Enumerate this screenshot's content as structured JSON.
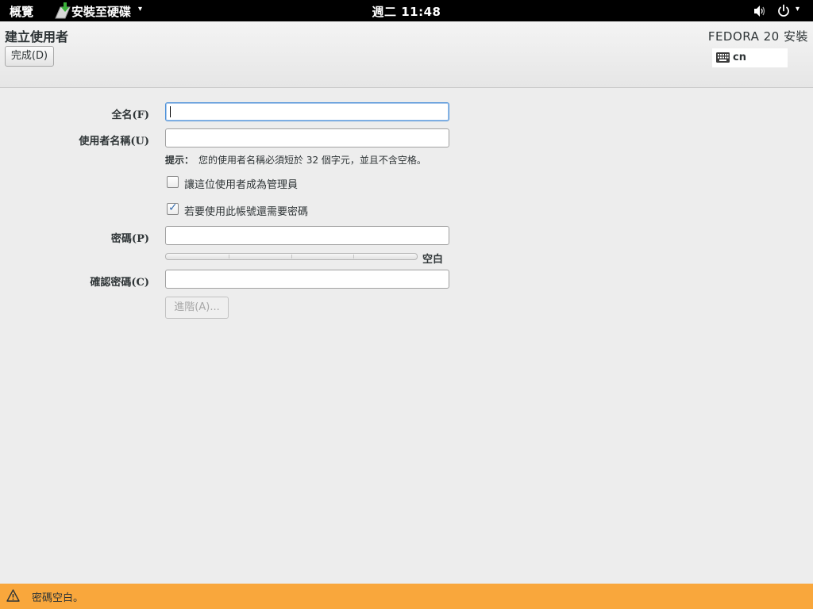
{
  "topbar": {
    "activities_label": "概覽",
    "app_name": "安裝至硬碟",
    "clock": "週二 11:48"
  },
  "header": {
    "title": "建立使用者",
    "done_label": "完成(D)",
    "product_title": "FEDORA 20 安裝",
    "keyboard_layout": "cn"
  },
  "form": {
    "fullname_label": "全名(F)",
    "fullname_value": "",
    "username_label": "使用者名稱(U)",
    "username_value": "",
    "hint_label": "提示：",
    "hint_text": "您的使用者名稱必須短於 32 個字元，並且不含空格。",
    "admin_checkbox_label": "讓這位使用者成為管理員",
    "admin_checked": false,
    "require_password_label": "若要使用此帳號還需要密碼",
    "require_password_checked": true,
    "password_label": "密碼(P)",
    "password_value": "",
    "strength_label": "空白",
    "strength_level": 0,
    "confirm_label": "確認密碼(C)",
    "confirm_value": "",
    "advanced_label": "進階(A)..."
  },
  "warning": {
    "text": "密碼空白。",
    "color": "#f9a73c"
  },
  "icons": {
    "app": "installer-icon",
    "volume": "volume-icon",
    "power": "power-icon",
    "keyboard": "keyboard-icon",
    "warning": "warning-icon"
  }
}
